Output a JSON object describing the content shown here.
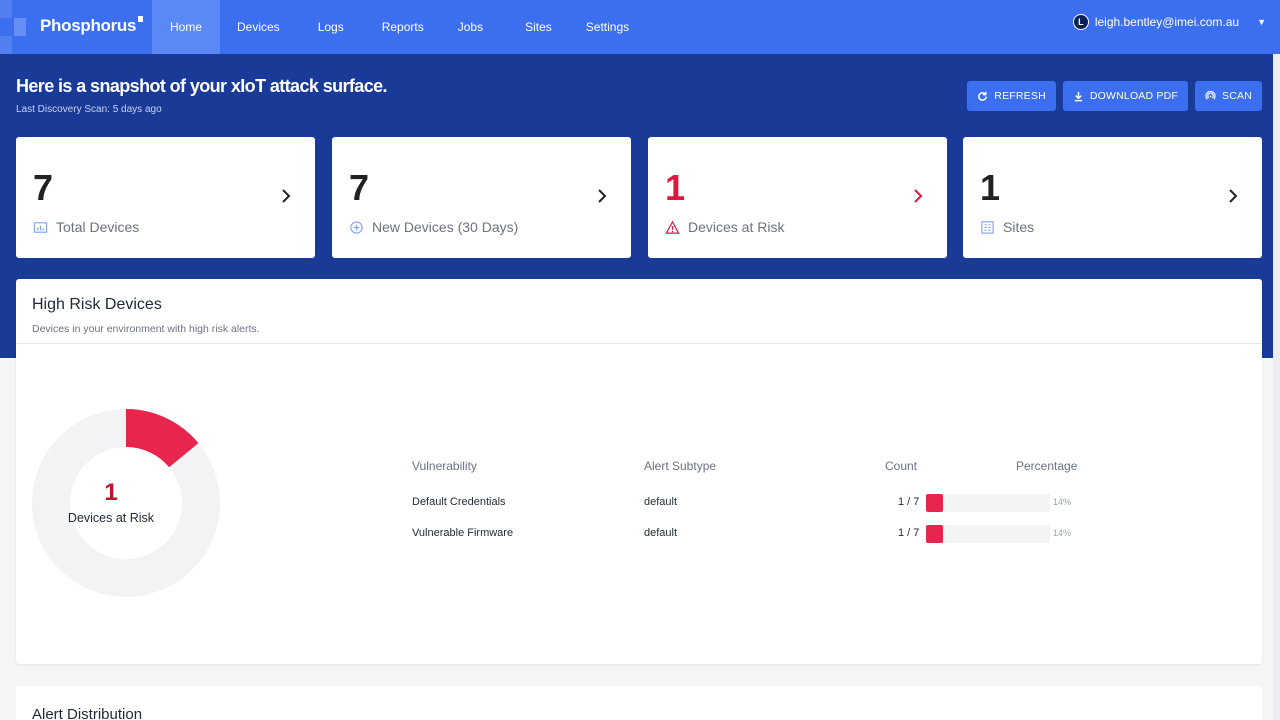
{
  "brand": {
    "name": "Phosphorus"
  },
  "nav": {
    "items": [
      {
        "label": "Home",
        "active": true
      },
      {
        "label": "Devices"
      },
      {
        "label": "Logs"
      },
      {
        "label": "Reports"
      },
      {
        "label": "Jobs"
      },
      {
        "label": "Sites"
      },
      {
        "label": "Settings"
      }
    ]
  },
  "user": {
    "initial": "L",
    "email": "leigh.bentley@imei.com.au"
  },
  "hero": {
    "title": "Here is a snapshot of your xIoT attack surface.",
    "subtitle": "Last Discovery Scan: 5 days ago",
    "buttons": {
      "refresh": "REFRESH",
      "download": "DOWNLOAD PDF",
      "scan": "SCAN"
    }
  },
  "cards": [
    {
      "value": "7",
      "label": "Total Devices",
      "icon": "device-chart-icon"
    },
    {
      "value": "7",
      "label": "New Devices (30 Days)",
      "icon": "add-circle-icon"
    },
    {
      "value": "1",
      "label": "Devices at Risk",
      "icon": "warning-icon",
      "color": "#e0163f"
    },
    {
      "value": "1",
      "label": "Sites",
      "icon": "building-icon"
    }
  ],
  "high_risk": {
    "title": "High Risk Devices",
    "subtitle": "Devices in your environment with high risk alerts.",
    "donut": {
      "value": "1",
      "label": "Devices at Risk",
      "fraction": 0.14,
      "colors": {
        "risk": "#e8264d",
        "rest": "#f3f3f5"
      }
    },
    "table": {
      "headers": {
        "vulnerability": "Vulnerability",
        "subtype": "Alert Subtype",
        "count": "Count",
        "percentage": "Percentage"
      },
      "rows": [
        {
          "vulnerability": "Default Credentials",
          "subtype": "default",
          "count": "1 / 7",
          "percent": 14,
          "percent_label": "14%"
        },
        {
          "vulnerability": "Vulnerable Firmware",
          "subtype": "default",
          "count": "1 / 7",
          "percent": 14,
          "percent_label": "14%"
        }
      ]
    }
  },
  "alert_distribution": {
    "title": "Alert Distribution"
  }
}
